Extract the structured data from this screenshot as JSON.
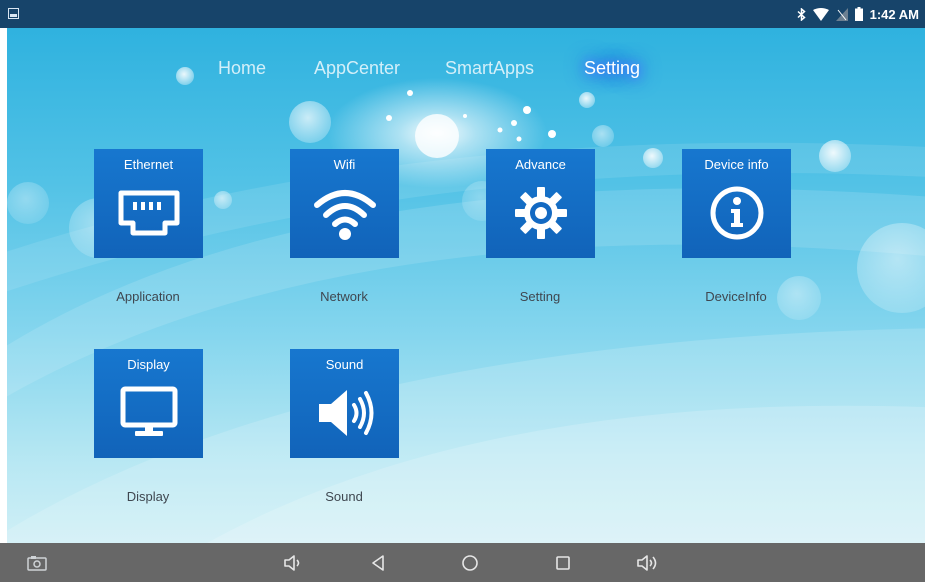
{
  "status_bar": {
    "time": "1:42 AM",
    "icons": [
      "bluetooth-icon",
      "wifi-signal-icon",
      "no-sim-icon",
      "battery-icon"
    ],
    "notification_icon": "image-notification-icon"
  },
  "tabs": [
    {
      "label": "Home",
      "active": false
    },
    {
      "label": "AppCenter",
      "active": false
    },
    {
      "label": "SmartApps",
      "active": false
    },
    {
      "label": "Setting",
      "active": true
    }
  ],
  "tiles": [
    {
      "title": "Ethernet",
      "caption": "Application",
      "icon": "ethernet-icon"
    },
    {
      "title": "Wifi",
      "caption": "Network",
      "icon": "wifi-icon"
    },
    {
      "title": "Advance",
      "caption": "Setting",
      "icon": "gear-icon"
    },
    {
      "title": "Device info",
      "caption": "DeviceInfo",
      "icon": "info-icon"
    },
    {
      "title": "Display",
      "caption": "Display",
      "icon": "monitor-icon"
    },
    {
      "title": "Sound",
      "caption": "Sound",
      "icon": "speaker-icon"
    }
  ],
  "nav_bar": {
    "buttons": [
      "screenshot-icon",
      "volume-down-icon",
      "back-icon",
      "home-icon",
      "recents-icon",
      "volume-up-icon"
    ]
  },
  "colors": {
    "tile": "#1565c0",
    "status_bar": "#17446a",
    "nav_bar": "#676767",
    "active_tab_glow": "#3a60ff"
  }
}
